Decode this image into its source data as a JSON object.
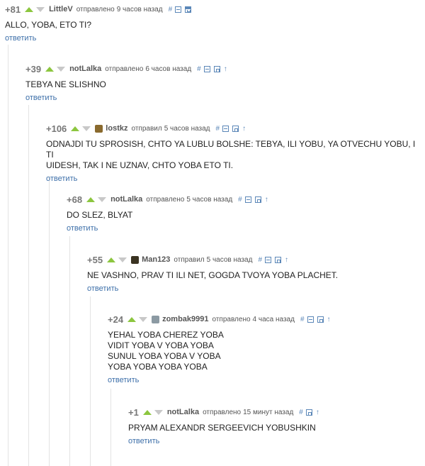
{
  "comments": [
    {
      "score": "+81",
      "user": "LittleV",
      "verb": "отправлено",
      "time": "9 часов назад",
      "text": [
        "ALLO, YOBA, ETO TI?"
      ],
      "reply": "ответить"
    },
    {
      "score": "+39",
      "user": "notLalka",
      "verb": "отправлено",
      "time": "6 часов назад",
      "text": [
        "TEBYA NE SLISHNO"
      ],
      "reply": "ответить"
    },
    {
      "score": "+106",
      "user": "lostkz",
      "verb": "отправил",
      "time": "5 часов назад",
      "text": [
        "ODNAJDI TU SPROSISH, CHTO YA LUBLU BOLSHE: TEBYA, ILI YOBU, YA OTVECHU YOBU, I TI",
        "UIDESH, TAK I NE UZNAV, CHTO YOBA ETO TI."
      ],
      "reply": "ответить"
    },
    {
      "score": "+68",
      "user": "notLalka",
      "verb": "отправлено",
      "time": "5 часов назад",
      "text": [
        "DO SLEZ, BLYAT"
      ],
      "reply": "ответить"
    },
    {
      "score": "+55",
      "user": "Man123",
      "verb": "отправил",
      "time": "5 часов назад",
      "text": [
        "NE VASHNO, PRAV TI ILI NET, GOGDA TVOYA YOBA PLACHET."
      ],
      "reply": "ответить"
    },
    {
      "score": "+24",
      "user": "zombak9991",
      "verb": "отправлено",
      "time": "4 часа назад",
      "text": [
        "YEHAL YOBA CHEREZ YOBA",
        "VIDIT YOBA V YOBA YOBA",
        "SUNUL YOBA YOBA V YOBA",
        "YOBA YOBA YOBA YOBA"
      ],
      "reply": "ответить"
    },
    {
      "score": "+1",
      "user": "notLalka",
      "verb": "отправлено",
      "time": "15 минут назад",
      "text": [
        "PRYAM ALEXANDR SERGEEVICH YOBUSHKIN"
      ],
      "reply": "ответить"
    }
  ],
  "tools": {
    "hash": "#"
  },
  "colors": {
    "upvote": "#8cc63f",
    "downvote": "#c8c8c8",
    "link": "#3d6fa9",
    "thread_line": "#e3e3e3"
  }
}
